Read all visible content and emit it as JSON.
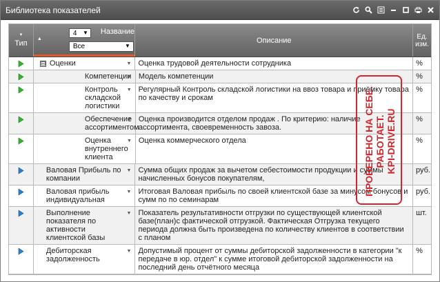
{
  "window": {
    "title": "Библиотека показателей"
  },
  "toolbar_icons": [
    "refresh-icon",
    "search-icon",
    "list-icon",
    "minimize-icon",
    "maximize-icon",
    "print-icon",
    "close-icon"
  ],
  "header": {
    "type_label": "Тип",
    "name_label": "Название",
    "level_value": "4",
    "filter_value": "Все",
    "desc_label": "Описание",
    "unit_label_line1": "Ед.",
    "unit_label_line2": "изм."
  },
  "rows": [
    {
      "icon": "green-arrow",
      "toggle": "⊟",
      "name": "Оценки",
      "desc": "Оценка трудовой деятельности сотрудника",
      "unit": "%"
    },
    {
      "icon": "green-arrow",
      "name": "Компетенции",
      "desc": "Модель компетенции",
      "unit": "%"
    },
    {
      "icon": "green-arrow",
      "name": "Контроль складской логистики",
      "desc": "Регулярный Контроль складской логистики на ввоз товара и приёмку товара по качеству и срокам",
      "unit": "%"
    },
    {
      "icon": "green-arrow",
      "name": "Обеспечение ассортиментом",
      "desc": "Оценка производится отделом продаж . По критерию: наличие ассортимента, своевременность завоза.",
      "unit": "%"
    },
    {
      "icon": "green-arrow",
      "name": "Оценка внутреннего клиента",
      "desc": "Оценка коммерческого отдела",
      "unit": "%"
    },
    {
      "icon": "blue-arrow",
      "name": "Валовая Прибыль по компании",
      "desc": "Сумма общих продаж за вычетом себестоимости продукции и суммы начисленных бонусов покупателям,",
      "unit": "руб."
    },
    {
      "icon": "blue-arrow",
      "name": "Валовая прибыль индивидуальная",
      "desc": "Итоговая Валовая прибыль по своей клиентской базе за минусом бонусов и сумм по по семинарам",
      "unit": "руб."
    },
    {
      "icon": "blue-arrow",
      "name": "Выполнение показателя по активности клиентской базы",
      "desc": "Показатель результативности отгрузки по существующей клиентской базе(план)с фактической отгрузкой. Фактическая Отгрузка текущего периода должна быть произведена по количеству клиентов в соответствии с планом",
      "unit": "шт."
    },
    {
      "icon": "blue-arrow",
      "name": "Дебиторская задолженность",
      "desc": "Допустимый процент от суммы дебиторской задолженности в категории \"к передаче в юр. отдел\" к сумме итоговой дебиторской задолженности на последний день отчётного месяца",
      "unit": "%"
    }
  ],
  "stamp": {
    "line1": "ПРОВЕРЕНО НА СЕБЕ.",
    "line2": "РАБОТАЕТ.",
    "line3": "KPI-DRIVE.RU"
  },
  "colors": {
    "green_arrow": "#2fb62a",
    "blue_arrow": "#2a7fd0",
    "accent": "#e2572b",
    "stamp": "#d4252e"
  }
}
